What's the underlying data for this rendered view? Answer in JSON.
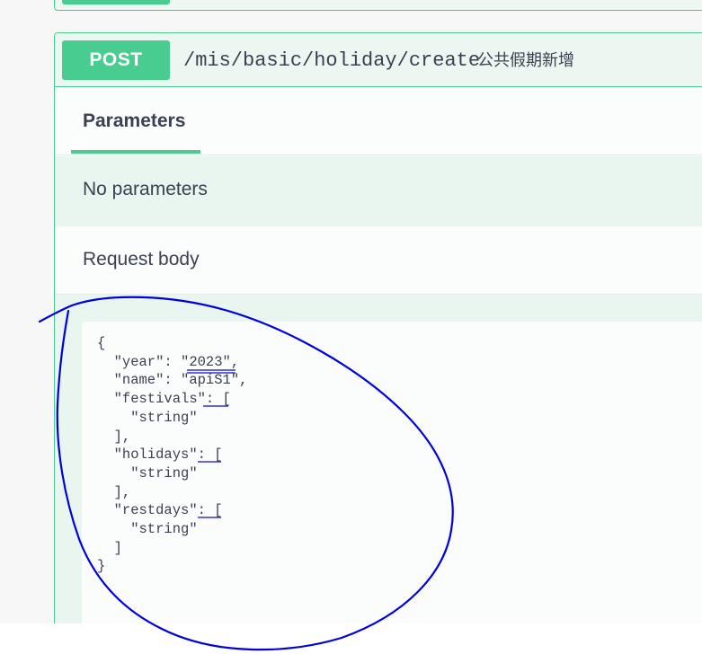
{
  "operation": {
    "method": "POST",
    "path": "/mis/basic/holiday/create",
    "description": "公共假期新增"
  },
  "tabs": {
    "parameters": "Parameters"
  },
  "parameters_section": {
    "empty_text": "No parameters"
  },
  "request_body": {
    "label": "Request body",
    "example": "{\n  \"year\": \"2023\",\n  \"name\": \"apiS1\",\n  \"festivals\": [\n    \"string\"\n  ],\n  \"holidays\": [\n    \"string\"\n  ],\n  \"restdays\": [\n    \"string\"\n  ]\n}"
  },
  "colors": {
    "post_green": "#49cc90",
    "annotation_blue": "#0000dd",
    "text": "#3b4151"
  }
}
